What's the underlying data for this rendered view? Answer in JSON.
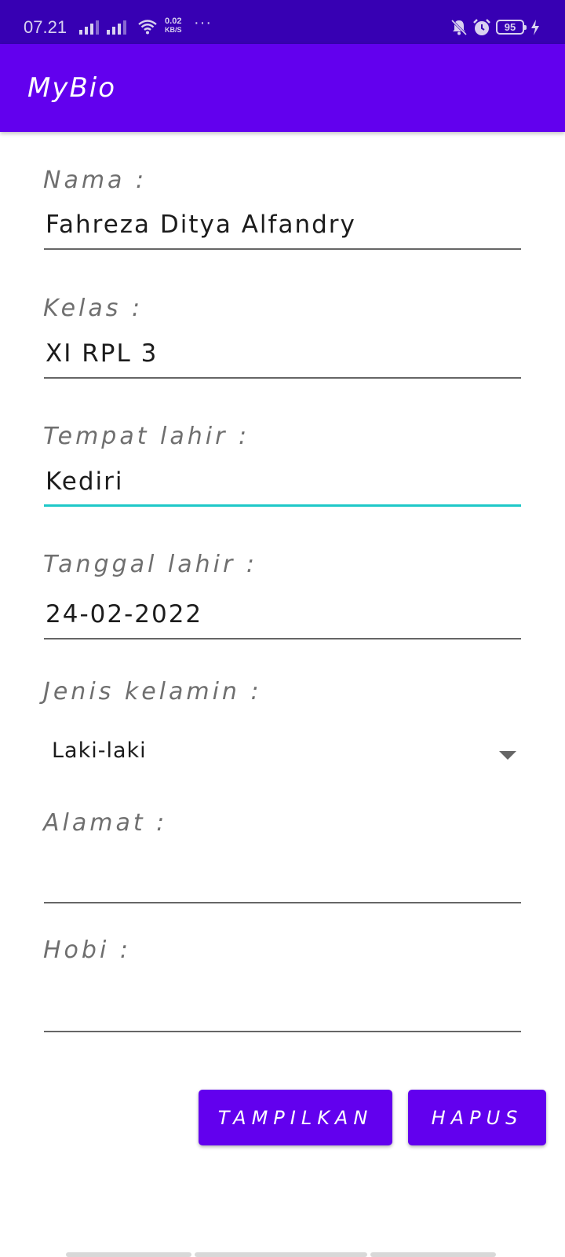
{
  "status_bar": {
    "time": "07.21",
    "speed_value": "0.02",
    "speed_unit": "KB/S",
    "more": "···",
    "battery": "95",
    "icons": [
      "signal-icon",
      "signal-icon",
      "wifi-icon",
      "bell-off-icon",
      "alarm-icon",
      "battery-icon",
      "charging-icon"
    ]
  },
  "app_bar": {
    "title": "MyBio"
  },
  "form": {
    "nama_label": "Nama :",
    "nama_value": "Fahreza Ditya Alfandry",
    "kelas_label": "Kelas :",
    "kelas_value": "XI RPL 3",
    "tempat_label": "Tempat lahir :",
    "tempat_value": "Kediri",
    "tanggal_label": "Tanggal lahir :",
    "tanggal_value": "24-02-2022",
    "jenis_label": "Jenis kelamin :",
    "jenis_value": "Laki-laki",
    "alamat_label": "Alamat :",
    "alamat_value": "",
    "hobi_label": "Hobi :",
    "hobi_value": ""
  },
  "buttons": {
    "show_label": "TAMPILKAN",
    "clear_label": "HAPUS"
  },
  "colors": {
    "status_bar": "#3700b3",
    "primary": "#6200ee",
    "focus_accent": "#1ec8c8"
  }
}
